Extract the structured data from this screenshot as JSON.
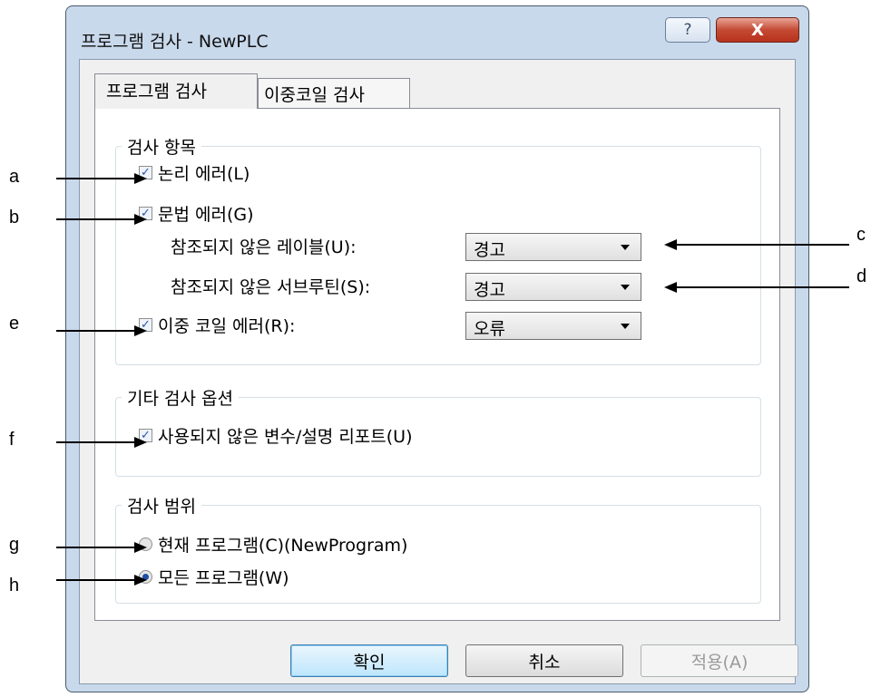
{
  "window": {
    "title": "프로그램 검사 - NewPLC",
    "help_glyph": "?",
    "close_glyph": "X"
  },
  "tabs": [
    {
      "label": "프로그램 검사",
      "active": true
    },
    {
      "label": "이중코일 검사",
      "active": false
    }
  ],
  "inspect_items": {
    "group_label": "검사 항목",
    "logic_error": {
      "label": "논리 에러(L)",
      "checked": true
    },
    "syntax_error": {
      "label": "문법 에러(G)",
      "checked": true
    },
    "unref_label": {
      "label": "참조되지 않은 레이블(U):",
      "value": "경고"
    },
    "unref_subroutine": {
      "label": "참조되지 않은 서브루틴(S):",
      "value": "경고"
    },
    "double_coil": {
      "label": "이중 코일 에러(R):",
      "checked": true,
      "value": "오류"
    }
  },
  "other_options": {
    "group_label": "기타 검사 옵션",
    "unused_report": {
      "label": "사용되지 않은 변수/설명 리포트(U)",
      "checked": true
    }
  },
  "scope": {
    "group_label": "검사 범위",
    "current_program": {
      "label": "현재 프로그램(C)(NewProgram)",
      "selected": false
    },
    "all_programs": {
      "label": "모든 프로그램(W)",
      "selected": true
    }
  },
  "buttons": {
    "ok": "확인",
    "cancel": "취소",
    "apply": "적용(A)"
  },
  "annotations": {
    "a": "a",
    "b": "b",
    "c": "c",
    "d": "d",
    "e": "e",
    "f": "f",
    "g": "g",
    "h": "h"
  },
  "colors": {
    "frame": "#c9d9ec",
    "close_button": "#c44a33",
    "check_mark": "#2a55a5"
  }
}
